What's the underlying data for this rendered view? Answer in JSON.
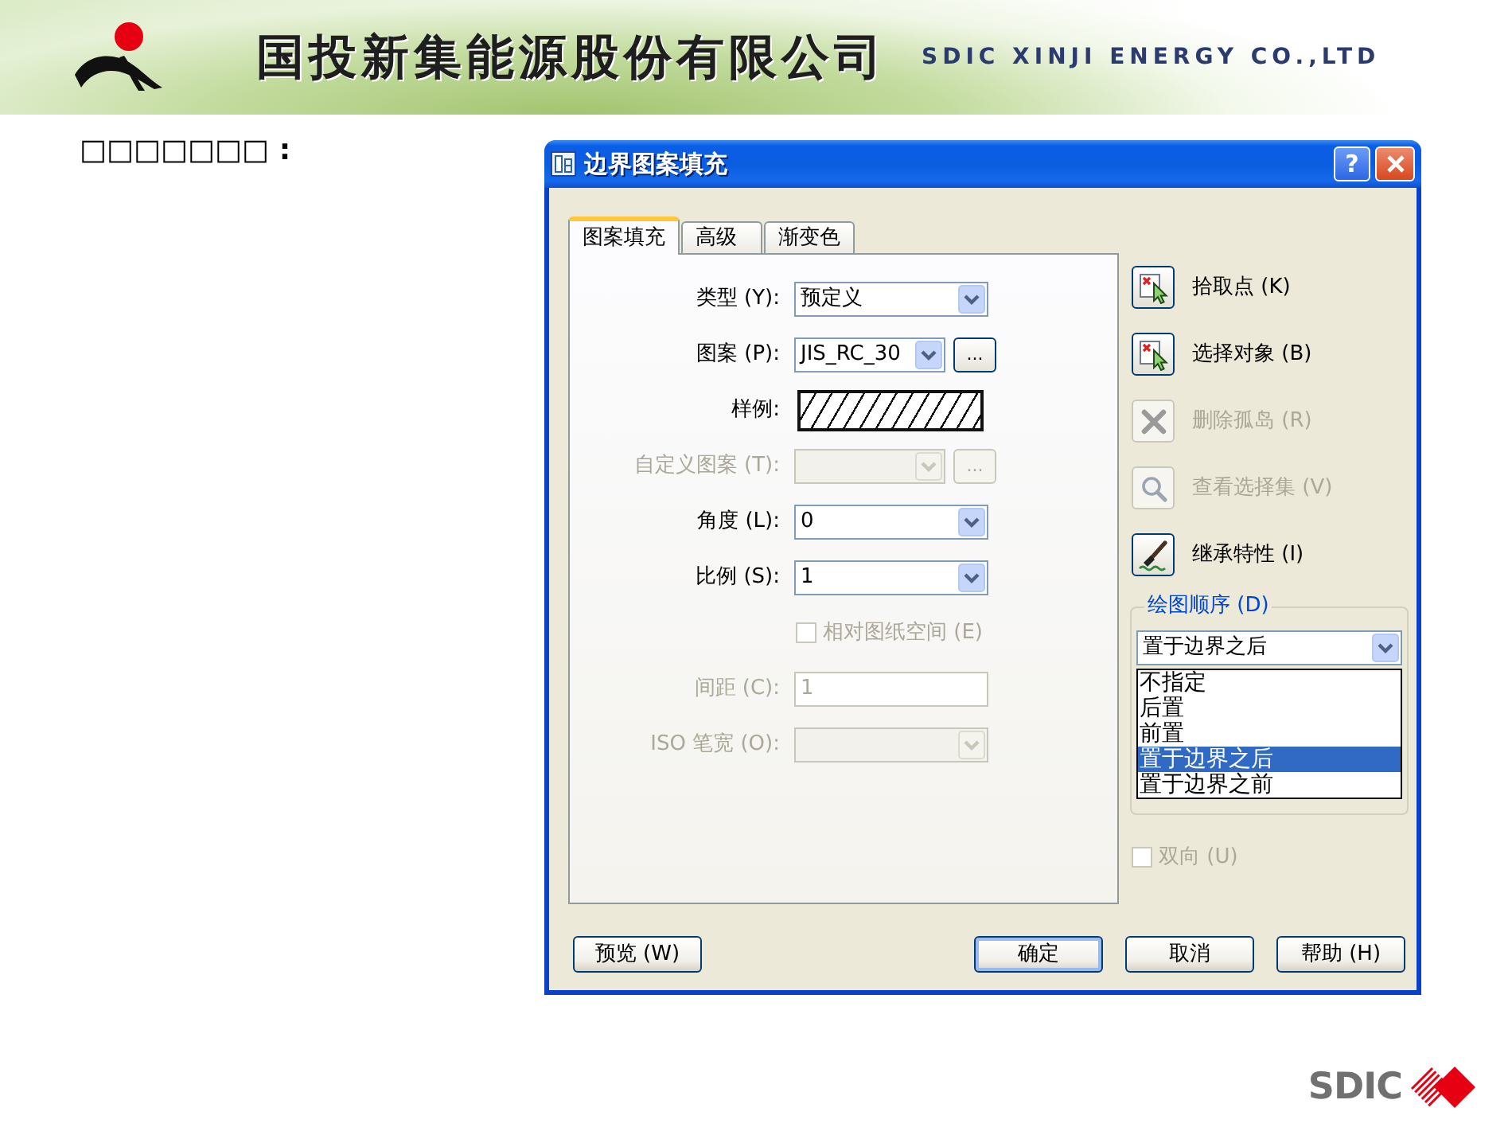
{
  "header": {
    "company_name": "国投新集能源股份有限公司",
    "company_name_en": "SDIC XINJI ENERGY CO.,LTD"
  },
  "heading": "□□□□□□□ :",
  "dialog": {
    "title": "边界图案填充",
    "help_label": "?",
    "tabs": [
      {
        "label": "图案填充",
        "selected": true
      },
      {
        "label": "高级",
        "selected": false
      },
      {
        "label": "渐变色",
        "selected": false
      }
    ],
    "fields": [
      {
        "kind": "select",
        "label": "类型 (Y):",
        "value": "预定义",
        "disabled": false
      },
      {
        "kind": "select_browse",
        "label": "图案 (P):",
        "value": "JIS_RC_30",
        "button_label": "...",
        "disabled": false
      },
      {
        "kind": "preview",
        "label": "样例:"
      },
      {
        "kind": "select_browse",
        "label": "自定义图案 (T):",
        "button_label": "...",
        "disabled": true
      },
      {
        "kind": "select",
        "label": "角度 (L):",
        "value": "0",
        "disabled": false
      },
      {
        "kind": "select",
        "label": "比例 (S):",
        "value": "1",
        "disabled": false
      },
      {
        "kind": "checkbox",
        "label": "相对图纸空间 (E)",
        "checked": false,
        "disabled": true
      },
      {
        "kind": "input",
        "label": "间距 (C):",
        "value": "1",
        "disabled": true
      },
      {
        "kind": "select",
        "label": "ISO 笔宽 (O):",
        "disabled": true
      }
    ],
    "tools": [
      {
        "kind": "pointer",
        "label": "拾取点 (K)",
        "disabled": false
      },
      {
        "kind": "pointer",
        "label": "选择对象 (B)",
        "disabled": false
      },
      {
        "kind": "cross",
        "label": "删除孤岛 (R)",
        "disabled": true
      },
      {
        "kind": "magnifier",
        "label": "查看选择集 (V)",
        "disabled": true
      },
      {
        "kind": "brush",
        "label": "继承特性 (I)",
        "disabled": false
      }
    ],
    "draw_order": {
      "label": "绘图顺序 (D)",
      "value": "置于边界之后",
      "options": [
        {
          "label": "不指定",
          "selected": false
        },
        {
          "label": "后置",
          "selected": false
        },
        {
          "label": "前置",
          "selected": false
        },
        {
          "label": "置于边界之后",
          "selected": true
        },
        {
          "label": "置于边界之前",
          "selected": false
        }
      ]
    },
    "bidirectional": {
      "label": "双向 (U)",
      "checked": false,
      "disabled": true
    },
    "buttons": [
      {
        "label": "预览 (W)",
        "default": false
      },
      {
        "label": "确定",
        "default": true
      },
      {
        "label": "取消",
        "default": false
      },
      {
        "label": "帮助 (H)",
        "default": false
      }
    ]
  },
  "footer": {
    "logo_text": "SDIC"
  }
}
